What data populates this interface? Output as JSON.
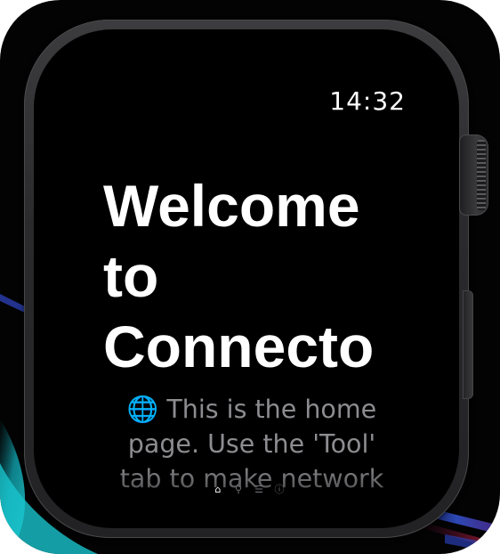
{
  "status_bar": {
    "time": "14:32"
  },
  "home": {
    "title": "Welcome\nto\nConnecto",
    "description": "🌐 This is the home page. Use the 'Tool' tab to make network"
  },
  "tab_bar": {
    "tabs": [
      {
        "icon": "house-icon",
        "glyph": "⌂",
        "active": true
      },
      {
        "icon": "wrench-icon",
        "glyph": "⚲",
        "active": false
      },
      {
        "icon": "list-icon",
        "glyph": "☰",
        "active": false
      },
      {
        "icon": "info-icon",
        "glyph": "ⓘ",
        "active": false
      }
    ]
  },
  "colors": {
    "background": "#000000",
    "text_primary": "#ffffff",
    "text_secondary": "#8d8d91",
    "case": "#2c2c2e",
    "accent_teal": "#0fb9c4"
  }
}
